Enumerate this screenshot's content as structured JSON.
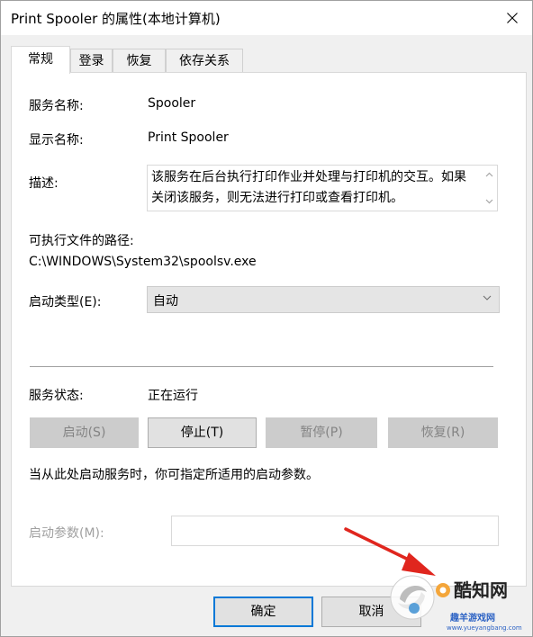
{
  "window": {
    "title": "Print Spooler 的属性(本地计算机)"
  },
  "tabs": [
    {
      "label": "常规"
    },
    {
      "label": "登录"
    },
    {
      "label": "恢复"
    },
    {
      "label": "依存关系"
    }
  ],
  "general": {
    "service_name_label": "服务名称:",
    "service_name_value": "Spooler",
    "display_name_label": "显示名称:",
    "display_name_value": "Print Spooler",
    "description_label": "描述:",
    "description_value": "该服务在后台执行打印作业并处理与打印机的交互。如果关闭该服务，则无法进行打印或查看打印机。",
    "path_label": "可执行文件的路径:",
    "path_value": "C:\\WINDOWS\\System32\\spoolsv.exe",
    "startup_type_label": "启动类型(E):",
    "startup_type_value": "自动",
    "status_label": "服务状态:",
    "status_value": "正在运行",
    "buttons": {
      "start": "启动(S)",
      "stop": "停止(T)",
      "pause": "暂停(P)",
      "resume": "恢复(R)"
    },
    "hint": "当从此处启动服务时，你可指定所适用的启动参数。",
    "params_label": "启动参数(M):",
    "params_value": ""
  },
  "footer": {
    "ok": "确定",
    "cancel": "取消"
  },
  "watermark": {
    "brand": "酷知网",
    "site": "趣羊游戏网",
    "url": "www.yueyangbang.com"
  },
  "colors": {
    "accent": "#0078d7",
    "arrow": "#e0261e",
    "window_bg": "#f0f0f0"
  },
  "icons": {
    "close": "close-icon",
    "combo": "chevron-down-icon",
    "scroll_up": "scroll-up-icon",
    "scroll_down": "scroll-down-icon"
  }
}
